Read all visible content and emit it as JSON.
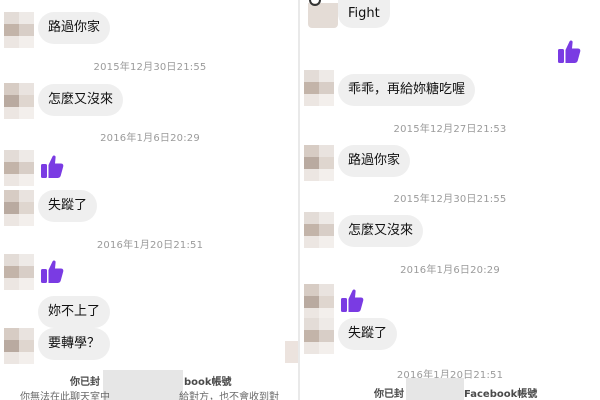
{
  "colors": {
    "like": "#7a3be3",
    "bubble": "#efefef",
    "timestamp": "#9b9b9b"
  },
  "left": {
    "messages": {
      "m1": "路過你家",
      "m2": "怎麼又沒來",
      "m3": "失蹤了",
      "m4": "妳不上了",
      "m5": "要轉學？"
    },
    "timestamps": {
      "t1": "2015年12月30日21:55",
      "t2": "2016年1月6日20:29",
      "t3": "2016年1月20日21:51"
    },
    "footer": {
      "title_start": "你已封",
      "title_end": "book帳號",
      "line_start": "你無法在此聊天室中",
      "line_end": "給對方，也不會收到對"
    },
    "icons": {
      "like": "thumbs-up-icon"
    }
  },
  "right": {
    "messages": {
      "m0": "Fight",
      "m1": "乖乖，再給妳糖吃喔",
      "m2": "路過你家",
      "m3": "怎麼又沒來",
      "m4": "失蹤了"
    },
    "timestamps": {
      "t1": "2015年12月27日21:53",
      "t2": "2015年12月30日21:55",
      "t3": "2016年1月6日20:29",
      "t4": "2016年1月20日21:51"
    },
    "footer": {
      "title_start": "你已封",
      "title_end": "Facebook帳號"
    },
    "icons": {
      "like": "thumbs-up-icon"
    }
  }
}
